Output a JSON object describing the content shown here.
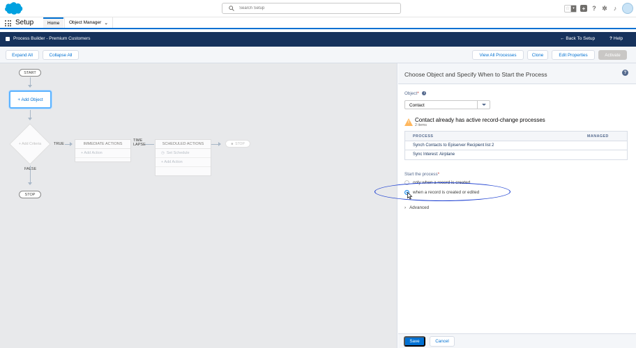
{
  "search": {
    "placeholder": "Search Setup"
  },
  "app_nav": {
    "app_name": "Setup",
    "tabs": [
      {
        "label": "Home",
        "active": true
      },
      {
        "label": "Object Manager",
        "active": false
      }
    ]
  },
  "header_icons": [
    "star-icon",
    "chevron-down-icon",
    "plus-icon",
    "help-icon",
    "gear-icon",
    "bell-icon",
    "avatar"
  ],
  "process_bar": {
    "title": "Process Builder - Premium Customers",
    "back_label": "Back To Setup",
    "help_label": "Help"
  },
  "toolbar": {
    "expand_all": "Expand All",
    "collapse_all": "Collapse All",
    "view_all_processes": "View All Processes",
    "clone": "Clone",
    "edit_properties": "Edit Properties",
    "activate": "Activate"
  },
  "canvas": {
    "start": "START",
    "add_object": "+ Add Object",
    "add_criteria": "+ Add Criteria",
    "true_label": "TRUE",
    "false_label": "FALSE",
    "time_lapse_1": "TIME",
    "time_lapse_2": "LAPSE",
    "immediate_actions": "IMMEDIATE ACTIONS",
    "add_action_1": "+ Add Action",
    "scheduled_actions": "SCHEDULED ACTIONS",
    "set_schedule": "Set Schedule",
    "add_action_2": "+ Add Action",
    "stop_ghost": "STOP",
    "stop": "STOP"
  },
  "panel": {
    "title": "Choose Object and Specify When to Start the Process",
    "object_label": "Object",
    "required_mark": "*",
    "object_value": "Contact",
    "warning_title": "Contact already has active record-change processes",
    "warning_sub": "2 items",
    "table": {
      "headers": [
        "PROCESS",
        "MANAGED"
      ],
      "rows": [
        {
          "process": "Synch Contacts to Episerver Recipient list 2",
          "managed": ""
        },
        {
          "process": "Sync Interest: Airplane",
          "managed": ""
        }
      ]
    },
    "start_label": "Start the process",
    "options": [
      {
        "label": "only when a record is created",
        "selected": false
      },
      {
        "label": "when a record is created or edited",
        "selected": true
      }
    ],
    "advanced": "Advanced",
    "save": "Save",
    "cancel": "Cancel"
  },
  "colors": {
    "brand_blue": "#0070d2",
    "title_bar": "#16325c",
    "warning": "#ffb75d",
    "annotation": "#1c3fd1"
  }
}
